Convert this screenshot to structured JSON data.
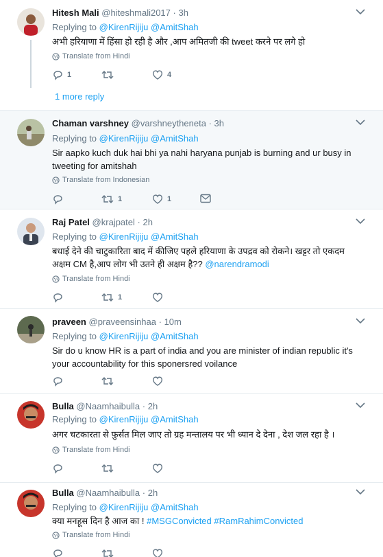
{
  "tweets": [
    {
      "name": "Hitesh Mali",
      "handle": "@hiteshmali2017",
      "time": "3h",
      "replying_label": "Replying to",
      "mentions": [
        "@KirenRijiju",
        "@AmitShah"
      ],
      "text": "अभी हरियाणा में हिंसा हो रही है और ,आप अमितजी की tweet करने पर लगे हो",
      "translate": "Translate from Hindi",
      "reply_count": "1",
      "retweet_count": "",
      "like_count": "4",
      "more_reply": "1 more reply"
    },
    {
      "name": "Chaman varshney",
      "handle": "@varshneytheneta",
      "time": "3h",
      "replying_label": "Replying to",
      "mentions": [
        "@KirenRijiju",
        "@AmitShah"
      ],
      "text": "Sir aapko kuch duk hai bhi ya nahi haryana punjab is burning and ur busy in tweeting for amitshah",
      "translate": "Translate from Indonesian",
      "reply_count": "",
      "retweet_count": "1",
      "like_count": "1"
    },
    {
      "name": "Raj Patel",
      "handle": "@krajpatel",
      "time": "2h",
      "replying_label": "Replying to",
      "mentions": [
        "@KirenRijiju",
        "@AmitShah"
      ],
      "text": "बधाई देने की चाटुकारिता बाद में कीजिए  पहले हरियाणा के उपद्रव को रोकने। खट्टर तो एकदम अक्षम CM है,आप लोग भी उतने ही अक्षम है?? ",
      "text_link": "@narendramodi",
      "translate": "Translate from Hindi",
      "reply_count": "",
      "retweet_count": "1",
      "like_count": ""
    },
    {
      "name": "praveen",
      "handle": "@praveensinhaa",
      "time": "10m",
      "replying_label": "Replying to",
      "mentions": [
        "@KirenRijiju",
        "@AmitShah"
      ],
      "text": "Sir do u know HR is a part of india and you are minister of indian republic it's your accountability for this sponersred voilance",
      "reply_count": "",
      "retweet_count": "",
      "like_count": ""
    },
    {
      "name": "Bulla",
      "handle": "@Naamhaibulla",
      "time": "2h",
      "replying_label": "Replying to",
      "mentions": [
        "@KirenRijiju",
        "@AmitShah"
      ],
      "text": "अगर चटकारता से फ़ुर्सत मिल जाए तो ग्रह मन्तालय पर भी ध्यान दे देना , देश जल रहा है ।",
      "translate": "Translate from Hindi",
      "reply_count": "",
      "retweet_count": "",
      "like_count": ""
    },
    {
      "name": "Bulla",
      "handle": "@Naamhaibulla",
      "time": "2h",
      "replying_label": "Replying to",
      "mentions": [
        "@KirenRijiju",
        "@AmitShah"
      ],
      "text": "क्या मनहूस दिन है आज का ! ",
      "text_links": [
        "#MSGConvicted",
        "#RamRahimConvicted"
      ],
      "translate": "Translate from Hindi",
      "reply_count": "",
      "retweet_count": "",
      "like_count": ""
    }
  ],
  "icons": {
    "reply": "reply-icon",
    "retweet": "retweet-icon",
    "like": "heart-icon",
    "dm": "envelope-icon",
    "translate": "globe-icon",
    "caret": "chevron-down-icon"
  },
  "colors": {
    "link": "#1da1f2",
    "muted": "#657786",
    "highlight_bg": "#f5f8fa",
    "thread_line": "#ccd6dd"
  }
}
